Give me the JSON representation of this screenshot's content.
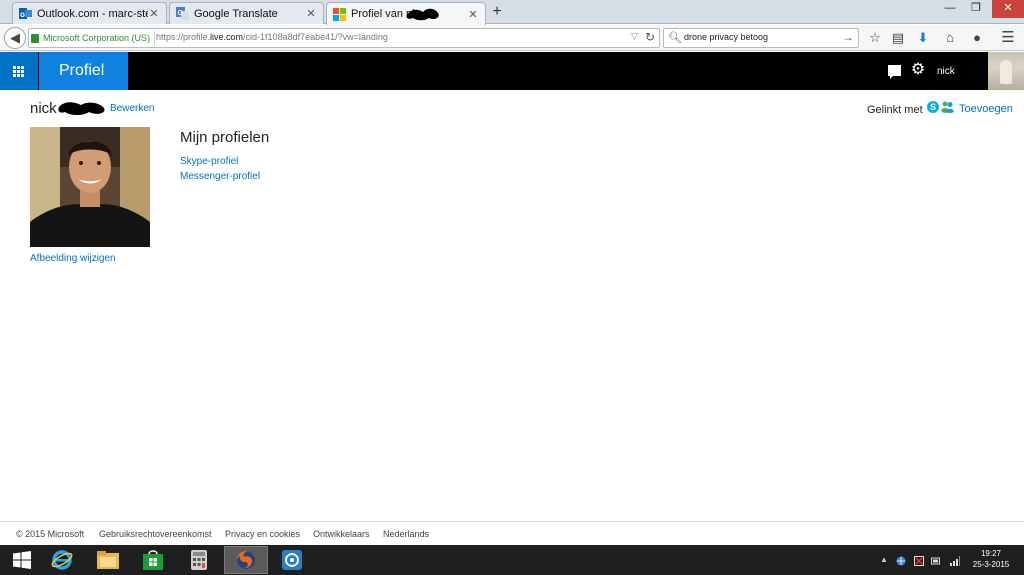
{
  "browser": {
    "tabs": [
      {
        "label": "Outlook.com - marc-steve..."
      },
      {
        "label": "Google Translate"
      },
      {
        "label": "Profiel van nic"
      }
    ],
    "new_tab": "+",
    "identity": "Microsoft Corporation (US)",
    "url_prefix": "https://profile.",
    "url_domain": "live.com",
    "url_suffix": "/cid-1f108a8df7eabe41/?vw=landing",
    "search_text": "drone privacy betoog",
    "colors": {
      "identity_green": "#2d8c2d",
      "tab_active": "#f5f6f7"
    }
  },
  "header": {
    "title": "Profiel",
    "username": "nick",
    "colors": {
      "brand": "#0072c6",
      "title_bg": "#0f82e0",
      "bar": "#000000"
    }
  },
  "profile": {
    "name": "nick",
    "edit_link": "Bewerken",
    "linked_label": "Gelinkt met",
    "add_link": "Toevoegen",
    "change_photo": "Afbeelding wijzigen",
    "profiles_heading": "Mijn profielen",
    "profile_links": [
      "Skype-profiel",
      "Messenger-profiel"
    ]
  },
  "footer": {
    "links": [
      "© 2015 Microsoft",
      "Gebruiksrechtovereenkomst",
      "Privacy en cookies",
      "Ontwikkelaars",
      "Nederlands"
    ]
  },
  "taskbar": {
    "time": "19:27",
    "date": "25-3-2015",
    "apps": [
      "start-icon",
      "internet-explorer-icon",
      "file-explorer-icon",
      "store-icon",
      "calculator-icon",
      "firefox-icon",
      "remote-desktop-icon"
    ]
  }
}
